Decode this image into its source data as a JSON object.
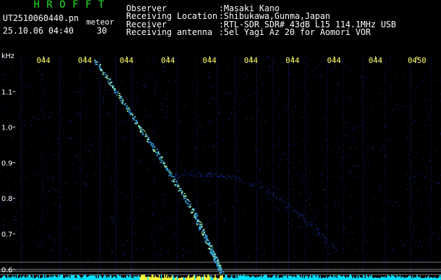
{
  "header": {
    "station": "HROFFT",
    "file_name": "UT2510060440.pn",
    "meteor_label": "meteor",
    "datetime": "25.10.06 04:40",
    "count": "30",
    "info": [
      {
        "label": "Observer",
        "value": ":Masaki Kano"
      },
      {
        "label": "Receiving Location",
        "value": ":Shibukawa,Gunma,Japan"
      },
      {
        "label": "Receiver",
        "value": ":RTL-SDR SDR# 43dB L15 114.1MHz USB"
      },
      {
        "label": "Receiving antenna",
        "value": ":5el Yagi Az 20 for Aomori VOR"
      }
    ]
  },
  "plot": {
    "y_unit": "kHz",
    "x_tick_labels": [
      "044",
      "044",
      "044",
      "044",
      "044",
      "044",
      "044",
      "044",
      "044",
      "0450"
    ],
    "y_tick_labels": [
      "1.1",
      "1.0",
      "0.9",
      "0.8",
      "0.7",
      "0.6"
    ],
    "colors": {
      "background": "#000000",
      "noise": "#1a2a9a",
      "trail_core": "#aaffaa",
      "trail": "#2f9fe0",
      "baseline": "#00e0ff",
      "burst": "#ffff40",
      "ref_lines": "#9a9a9a"
    }
  },
  "chart_data": {
    "type": "heatmap",
    "title": "",
    "xlabel": "",
    "ylabel": "kHz",
    "x_ticks": [
      "044",
      "044",
      "044",
      "044",
      "044",
      "044",
      "044",
      "044",
      "044",
      "0450"
    ],
    "y_ticks": [
      1.1,
      1.0,
      0.9,
      0.8,
      0.7,
      0.6
    ],
    "ylim": [
      0.57,
      1.2
    ],
    "meteor_trail": [
      {
        "x_min": 0.0,
        "freq_khz": 1.19
      },
      {
        "x_min": 1.0,
        "freq_khz": 1.05
      },
      {
        "x_min": 2.0,
        "freq_khz": 0.91
      },
      {
        "x_min": 3.0,
        "freq_khz": 0.76
      },
      {
        "x_min": 3.5,
        "freq_khz": 0.66
      },
      {
        "x_min": 3.85,
        "freq_khz": 0.59
      }
    ],
    "reference_lines_khz": [
      0.62,
      0.6,
      0.595,
      0.585,
      0.575
    ]
  }
}
